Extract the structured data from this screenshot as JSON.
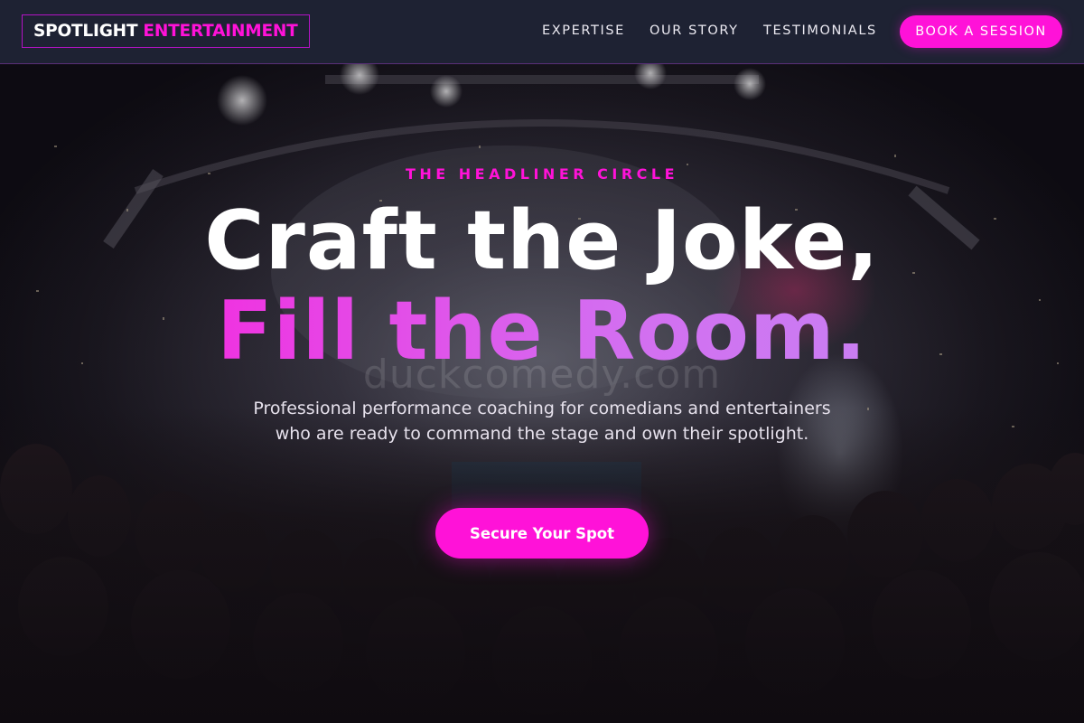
{
  "brand": {
    "name_white": "SPOTLIGHT",
    "name_pink": "ENTERTAINMENT"
  },
  "nav": {
    "links": [
      "EXPERTISE",
      "OUR STORY",
      "TESTIMONIALS"
    ],
    "cta": "BOOK A SESSION"
  },
  "hero": {
    "eyebrow": "THE HEADLINER CIRCLE",
    "headline_line1": "Craft the Joke,",
    "headline_line2": "Fill the Room.",
    "watermark": "duckcomedy.com",
    "subtitle": "Professional performance coaching for comedians and entertainers who are ready to command the stage and own their spotlight.",
    "cta": "Secure Your Spot"
  },
  "colors": {
    "accent": "#ff12d8",
    "nav_bg": "#1e2233",
    "gradient_end": "#c18cf4"
  }
}
